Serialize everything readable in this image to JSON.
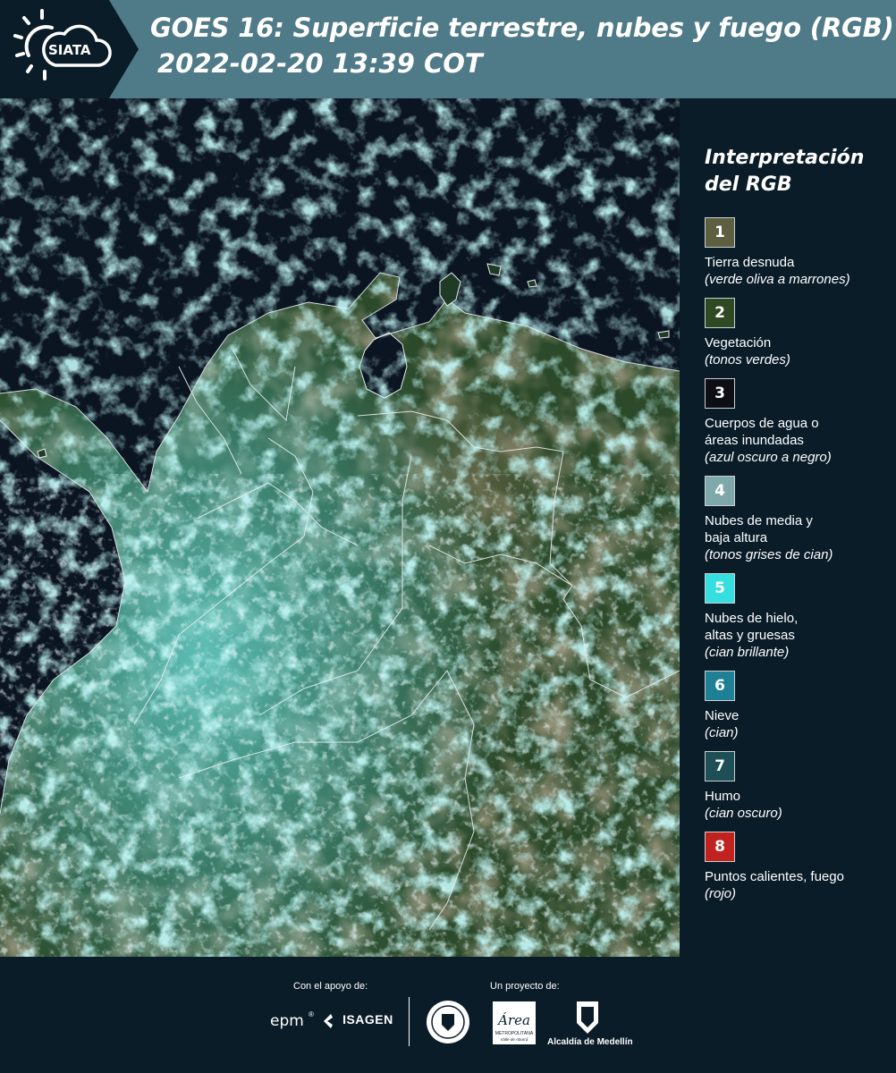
{
  "header": {
    "brand": "SIATA",
    "title": "GOES 16: Superficie terrestre, nubes y fuego (RGB)",
    "timestamp": "2022-02-20 13:39 COT"
  },
  "legend": {
    "title_line1": "Interpretación",
    "title_line2": "del RGB",
    "items": [
      {
        "num": "1",
        "label": "Tierra desnuda",
        "sub": "(verde oliva a marrones)",
        "color": "#5e5e40"
      },
      {
        "num": "2",
        "label": "Vegetación",
        "sub": "(tonos verdes)",
        "color": "#2f4a22"
      },
      {
        "num": "3",
        "label": "Cuerpos de agua o\náreas inundadas",
        "sub": "(azul oscuro a negro)",
        "color": "#0d0f14"
      },
      {
        "num": "4",
        "label": "Nubes de media y\nbaja altura",
        "sub": "(tonos grises de cian)",
        "color": "#7fa8aa"
      },
      {
        "num": "5",
        "label": "Nubes de hielo,\naltas y gruesas",
        "sub": "(cian brillante)",
        "color": "#35dfe0"
      },
      {
        "num": "6",
        "label": "Nieve",
        "sub": "(cian)",
        "color": "#1f7f94"
      },
      {
        "num": "7",
        "label": "Humo",
        "sub": "(cian oscuro)",
        "color": "#1e4e56"
      },
      {
        "num": "8",
        "label": "Puntos calientes, fuego",
        "sub": "(rojo)",
        "color": "#c2221f"
      }
    ]
  },
  "footer": {
    "support_label": "Con el apoyo de:",
    "project_label": "Un proyecto de:",
    "sponsor1": "epm",
    "sponsor2": "ISAGEN",
    "org_area_name": "Área",
    "org_area_sub1": "METROPOLITANA",
    "org_area_sub2": "Valle de Aburrá",
    "org_alcaldia": "Alcaldía de Medellín"
  }
}
